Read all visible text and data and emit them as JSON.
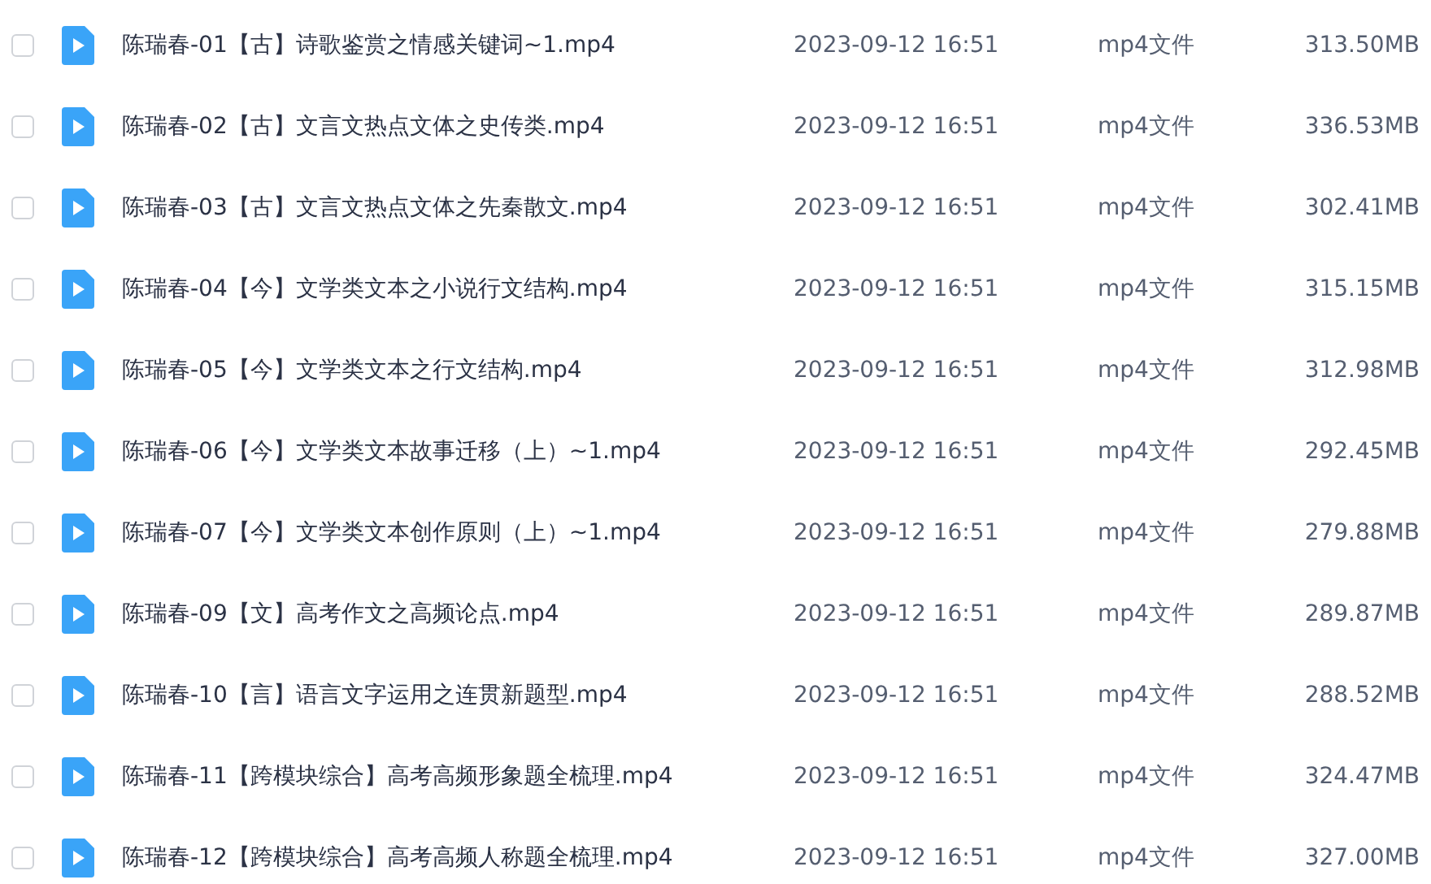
{
  "files": [
    {
      "name": "陈瑞春-01【古】诗歌鉴赏之情感关键词~1.mp4",
      "date": "2023-09-12 16:51",
      "type": "mp4文件",
      "size": "313.50MB",
      "checked": false
    },
    {
      "name": "陈瑞春-02【古】文言文热点文体之史传类.mp4",
      "date": "2023-09-12 16:51",
      "type": "mp4文件",
      "size": "336.53MB",
      "checked": false
    },
    {
      "name": "陈瑞春-03【古】文言文热点文体之先秦散文.mp4",
      "date": "2023-09-12 16:51",
      "type": "mp4文件",
      "size": "302.41MB",
      "checked": false
    },
    {
      "name": "陈瑞春-04【今】文学类文本之小说行文结构.mp4",
      "date": "2023-09-12 16:51",
      "type": "mp4文件",
      "size": "315.15MB",
      "checked": false
    },
    {
      "name": "陈瑞春-05【今】文学类文本之行文结构.mp4",
      "date": "2023-09-12 16:51",
      "type": "mp4文件",
      "size": "312.98MB",
      "checked": false
    },
    {
      "name": "陈瑞春-06【今】文学类文本故事迁移（上）~1.mp4",
      "date": "2023-09-12 16:51",
      "type": "mp4文件",
      "size": "292.45MB",
      "checked": false
    },
    {
      "name": "陈瑞春-07【今】文学类文本创作原则（上）~1.mp4",
      "date": "2023-09-12 16:51",
      "type": "mp4文件",
      "size": "279.88MB",
      "checked": false
    },
    {
      "name": "陈瑞春-09【文】高考作文之高频论点.mp4",
      "date": "2023-09-12 16:51",
      "type": "mp4文件",
      "size": "289.87MB",
      "checked": false
    },
    {
      "name": "陈瑞春-10【言】语言文字运用之连贯新题型.mp4",
      "date": "2023-09-12 16:51",
      "type": "mp4文件",
      "size": "288.52MB",
      "checked": false
    },
    {
      "name": "陈瑞春-11【跨模块综合】高考高频形象题全梳理.mp4",
      "date": "2023-09-12 16:51",
      "type": "mp4文件",
      "size": "324.47MB",
      "checked": false
    },
    {
      "name": "陈瑞春-12【跨模块综合】高考高频人称题全梳理.mp4",
      "date": "2023-09-12 16:51",
      "type": "mp4文件",
      "size": "327.00MB",
      "checked": false
    }
  ]
}
